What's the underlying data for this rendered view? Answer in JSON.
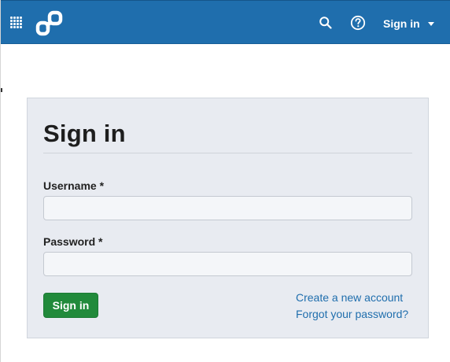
{
  "header": {
    "apps_icon": "grid-icon",
    "logo_icon": "openstreetmap-style-logo",
    "search_icon": "search-icon",
    "help_icon": "help-icon",
    "signin_label": "Sign in",
    "signin_caret_icon": "caret-down-icon",
    "bar_color": "#1f6ead"
  },
  "form": {
    "title": "Sign in",
    "username_label": "Username *",
    "username_value": "",
    "password_label": "Password *",
    "password_value": "",
    "submit_label": "Sign in",
    "submit_color": "#218a3b",
    "create_account_link": "Create a new account",
    "forgot_password_link": "Forgot your password?",
    "link_color": "#1f6ead"
  }
}
